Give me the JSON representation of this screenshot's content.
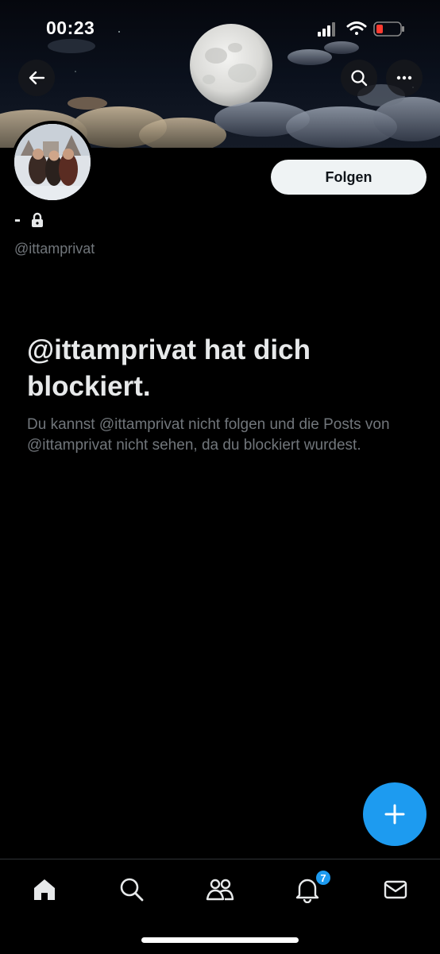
{
  "status_bar": {
    "time": "00:23"
  },
  "header": {
    "back_icon": "arrow-left-icon",
    "search_icon": "search-icon",
    "more_icon": "more-horizontal-icon"
  },
  "profile": {
    "display_name": "-",
    "protected_icon": "lock-icon",
    "handle": "@ittamprivat",
    "follow_label": "Folgen"
  },
  "blocked_notice": {
    "title": "@ittamprivat hat dich blockiert.",
    "description": "Du kannst @ittamprivat nicht folgen und die Posts von @ittamprivat nicht sehen, da du blockiert wurdest."
  },
  "compose_button": {
    "icon": "plus-icon"
  },
  "tab_bar": {
    "items": [
      {
        "icon": "home-icon"
      },
      {
        "icon": "search-icon"
      },
      {
        "icon": "communities-icon"
      },
      {
        "icon": "bell-icon",
        "badge": "7"
      },
      {
        "icon": "mail-icon"
      }
    ]
  },
  "colors": {
    "accent": "#1d9bf0",
    "background": "#000000",
    "primary_text": "#e7e9ea",
    "secondary_text": "#71767b"
  }
}
